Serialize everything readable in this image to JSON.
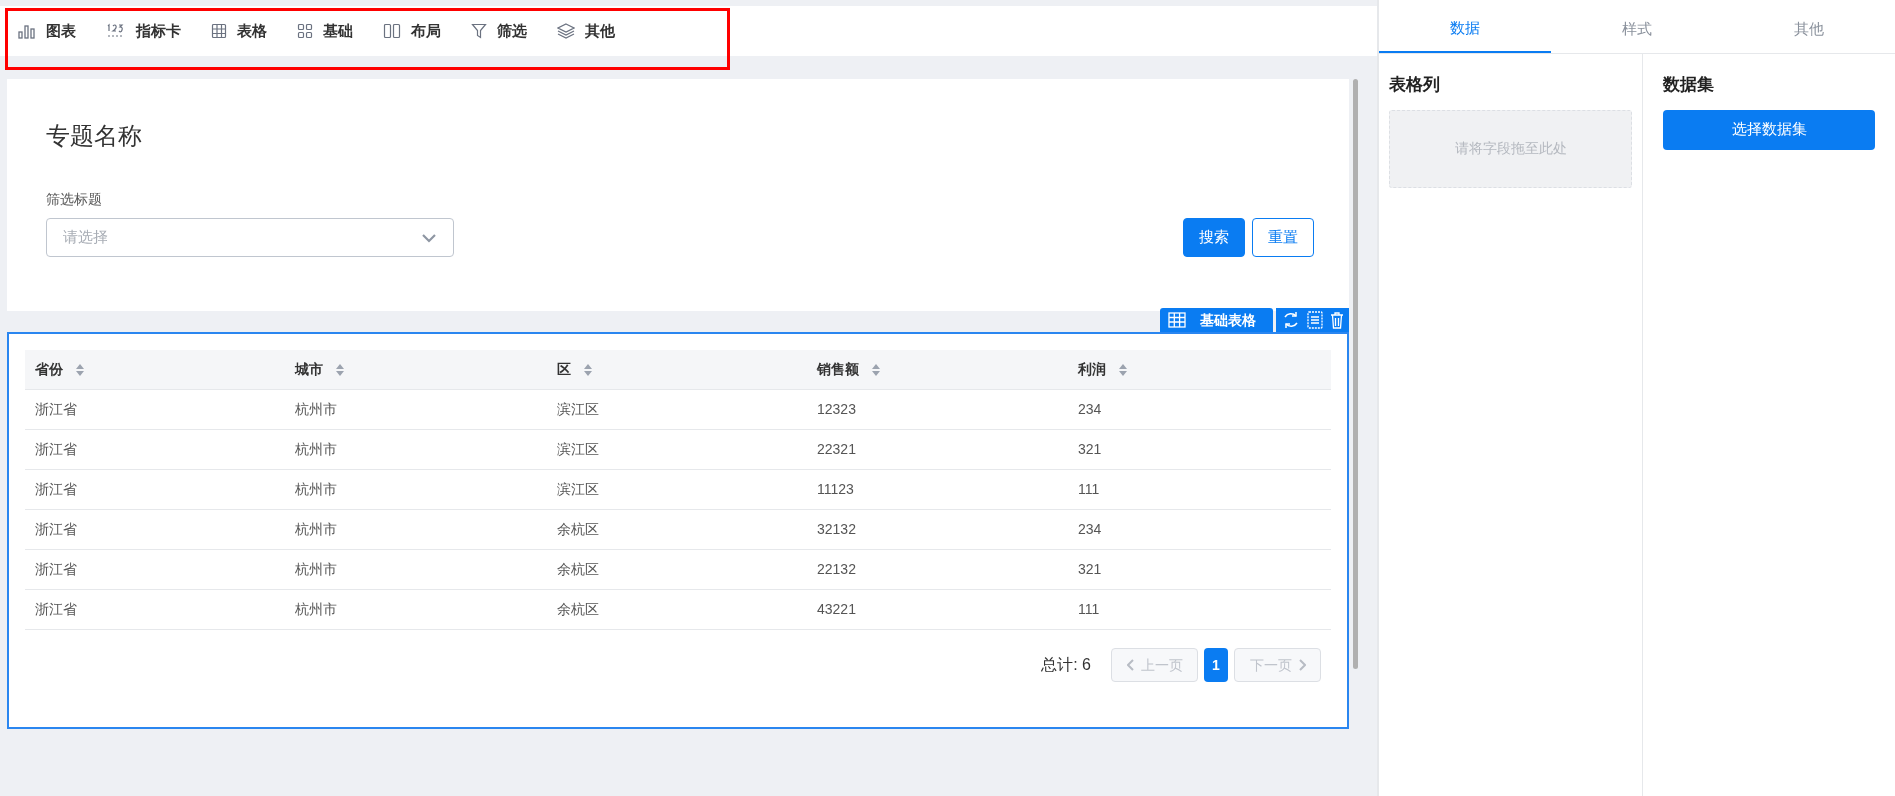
{
  "toolbar": {
    "items": [
      {
        "kind": "chart",
        "label": "图表"
      },
      {
        "kind": "metric",
        "label": "指标卡"
      },
      {
        "kind": "table",
        "label": "表格"
      },
      {
        "kind": "basic",
        "label": "基础"
      },
      {
        "kind": "layout",
        "label": "布局"
      },
      {
        "kind": "filter",
        "label": "筛选"
      },
      {
        "kind": "other",
        "label": "其他"
      }
    ]
  },
  "canvas": {
    "title": "专题名称",
    "filter": {
      "label": "筛选标题",
      "placeholder": "请选择"
    },
    "buttons": [
      {
        "label": "搜索",
        "kind": "primary"
      },
      {
        "label": "重置",
        "kind": "outline"
      }
    ],
    "widget_tag": "基础表格",
    "table": {
      "columns": [
        "省份",
        "城市",
        "区",
        "销售额",
        "利润"
      ],
      "rows": [
        [
          "浙江省",
          "杭州市",
          "滨江区",
          "12323",
          "234"
        ],
        [
          "浙江省",
          "杭州市",
          "滨江区",
          "22321",
          "321"
        ],
        [
          "浙江省",
          "杭州市",
          "滨江区",
          "11123",
          "111"
        ],
        [
          "浙江省",
          "杭州市",
          "余杭区",
          "32132",
          "234"
        ],
        [
          "浙江省",
          "杭州市",
          "余杭区",
          "22132",
          "321"
        ],
        [
          "浙江省",
          "杭州市",
          "余杭区",
          "43221",
          "111"
        ]
      ]
    },
    "pagination": {
      "total": "总计: 6",
      "prev": "上一页",
      "next": "下一页",
      "pages": [
        {
          "label": "1",
          "selected": true
        }
      ]
    }
  },
  "panel": {
    "tabs": [
      {
        "label": "数据",
        "selected": true
      },
      {
        "label": "样式",
        "selected": false
      },
      {
        "label": "其他",
        "selected": false
      }
    ],
    "columns_section": {
      "title": "表格列",
      "dropzone": "请将字段拖至此处"
    },
    "dataset_section": {
      "title": "数据集",
      "button": "选择数据集"
    }
  }
}
